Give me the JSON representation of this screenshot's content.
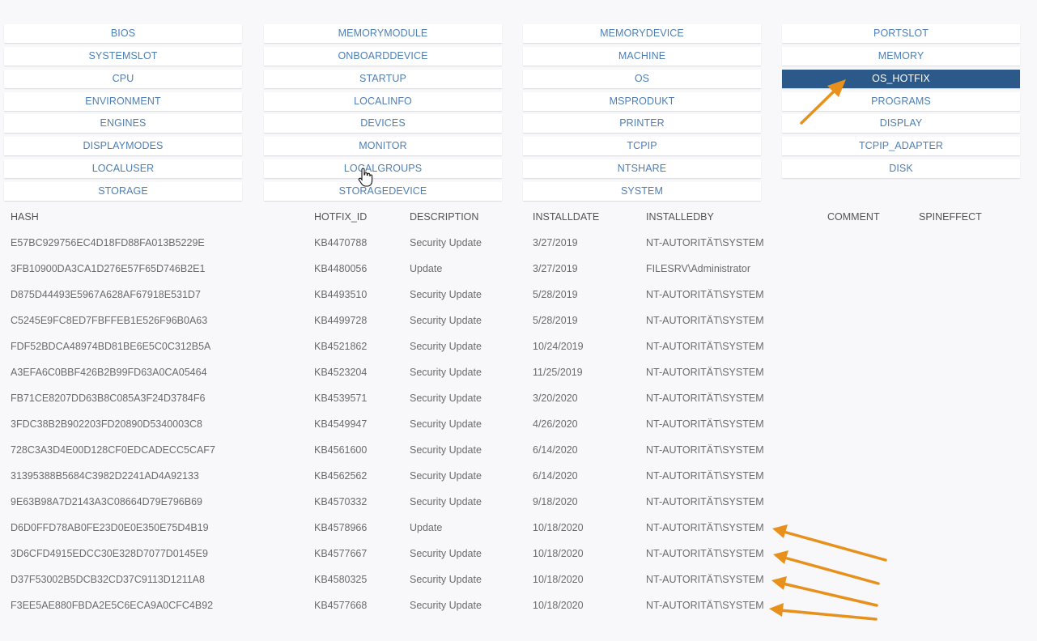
{
  "nav": {
    "columns": [
      [
        "BIOS",
        "SYSTEMSLOT",
        "CPU",
        "ENVIRONMENT",
        "ENGINES",
        "DISPLAYMODES",
        "LOCALUSER",
        "STORAGE"
      ],
      [
        "MEMORYMODULE",
        "ONBOARDDEVICE",
        "STARTUP",
        "LOCALINFO",
        "DEVICES",
        "MONITOR",
        "LOCALGROUPS",
        "STORAGEDEVICE"
      ],
      [
        "MEMORYDEVICE",
        "MACHINE",
        "OS",
        "MSPRODUKT",
        "PRINTER",
        "TCPIP",
        "NTSHARE",
        "SYSTEM"
      ],
      [
        "PORTSLOT",
        "MEMORY",
        "OS_HOTFIX",
        "PROGRAMS",
        "DISPLAY",
        "TCPIP_ADAPTER",
        "DISK"
      ]
    ],
    "active": "OS_HOTFIX"
  },
  "table": {
    "headers": {
      "hash": "HASH",
      "hotfix_id": "HOTFIX_ID",
      "description": "DESCRIPTION",
      "installdate": "INSTALLDATE",
      "installedby": "INSTALLEDBY",
      "comment": "COMMENT",
      "spineffect": "SPINEFFECT"
    },
    "rows": [
      {
        "hash": "E57BC929756EC4D18FD88FA013B5229E",
        "hotfix_id": "KB4470788",
        "description": "Security Update",
        "installdate": "3/27/2019",
        "installedby": "NT-AUTORITÄT\\SYSTEM"
      },
      {
        "hash": "3FB10900DA3CA1D276E57F65D746B2E1",
        "hotfix_id": "KB4480056",
        "description": "Update",
        "installdate": "3/27/2019",
        "installedby": "FILESRV\\Administrator"
      },
      {
        "hash": "D875D44493E5967A628AF67918E531D7",
        "hotfix_id": "KB4493510",
        "description": "Security Update",
        "installdate": "5/28/2019",
        "installedby": "NT-AUTORITÄT\\SYSTEM"
      },
      {
        "hash": "C5245E9FC8ED7FBFFEB1E526F96B0A63",
        "hotfix_id": "KB4499728",
        "description": "Security Update",
        "installdate": "5/28/2019",
        "installedby": "NT-AUTORITÄT\\SYSTEM"
      },
      {
        "hash": "FDF52BDCA48974BD81BE6E5C0C312B5A",
        "hotfix_id": "KB4521862",
        "description": "Security Update",
        "installdate": "10/24/2019",
        "installedby": "NT-AUTORITÄT\\SYSTEM"
      },
      {
        "hash": "A3EFA6C0BBF426B2B99FD63A0CA05464",
        "hotfix_id": "KB4523204",
        "description": "Security Update",
        "installdate": "11/25/2019",
        "installedby": "NT-AUTORITÄT\\SYSTEM"
      },
      {
        "hash": "FB71CE8207DD63B8C085A3F24D3784F6",
        "hotfix_id": "KB4539571",
        "description": "Security Update",
        "installdate": "3/20/2020",
        "installedby": "NT-AUTORITÄT\\SYSTEM"
      },
      {
        "hash": "3FDC38B2B902203FD20890D5340003C8",
        "hotfix_id": "KB4549947",
        "description": "Security Update",
        "installdate": "4/26/2020",
        "installedby": "NT-AUTORITÄT\\SYSTEM"
      },
      {
        "hash": "728C3A3D4E00D128CF0EDCADECC5CAF7",
        "hotfix_id": "KB4561600",
        "description": "Security Update",
        "installdate": "6/14/2020",
        "installedby": "NT-AUTORITÄT\\SYSTEM"
      },
      {
        "hash": "31395388B5684C3982D2241AD4A92133",
        "hotfix_id": "KB4562562",
        "description": "Security Update",
        "installdate": "6/14/2020",
        "installedby": "NT-AUTORITÄT\\SYSTEM"
      },
      {
        "hash": "9E63B98A7D2143A3C08664D79E796B69",
        "hotfix_id": "KB4570332",
        "description": "Security Update",
        "installdate": "9/18/2020",
        "installedby": "NT-AUTORITÄT\\SYSTEM"
      },
      {
        "hash": "D6D0FFD78AB0FE23D0E0E350E75D4B19",
        "hotfix_id": "KB4578966",
        "description": "Update",
        "installdate": "10/18/2020",
        "installedby": "NT-AUTORITÄT\\SYSTEM"
      },
      {
        "hash": "3D6CFD4915EDCC30E328D7077D0145E9",
        "hotfix_id": "KB4577667",
        "description": "Security Update",
        "installdate": "10/18/2020",
        "installedby": "NT-AUTORITÄT\\SYSTEM"
      },
      {
        "hash": "D37F53002B5DCB32CD37C9113D1211A8",
        "hotfix_id": "KB4580325",
        "description": "Security Update",
        "installdate": "10/18/2020",
        "installedby": "NT-AUTORITÄT\\SYSTEM"
      },
      {
        "hash": "F3EE5AE880FBDA2E5C6ECA9A0CFC4B92",
        "hotfix_id": "KB4577668",
        "description": "Security Update",
        "installdate": "10/18/2020",
        "installedby": "NT-AUTORITÄT\\SYSTEM"
      }
    ]
  },
  "colors": {
    "link": "#4e7fb4",
    "active_bg": "#2b5a8a",
    "annotation_arrow": "#e8901c"
  },
  "icons": {
    "cursor": "hand-pointer-icon",
    "annotation": "arrow-icon"
  }
}
